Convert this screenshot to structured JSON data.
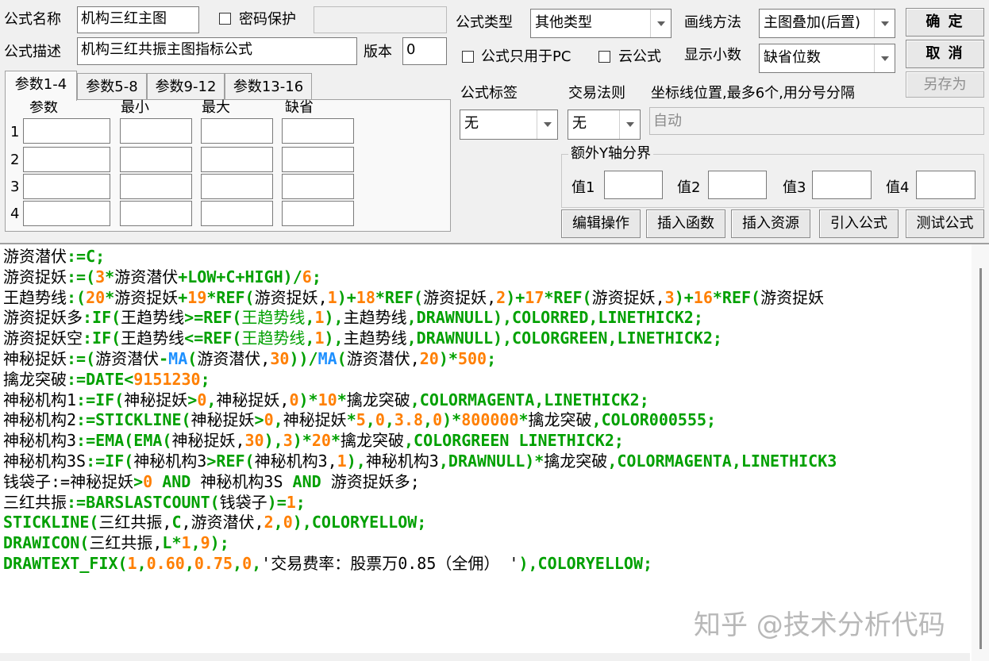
{
  "header": {
    "name_label": "公式名称",
    "name_value": "机构三红主图",
    "password_label": "密码保护",
    "desc_label": "公式描述",
    "desc_value": "机构三红共振主图指标公式",
    "version_label": "版本",
    "version_value": "0",
    "type_label": "公式类型",
    "type_value": "其他类型",
    "draw_label": "画线方法",
    "draw_value": "主图叠加(后置)",
    "pc_only_label": "公式只用于PC",
    "cloud_label": "云公式",
    "decimals_label": "显示小数",
    "decimals_value": "缺省位数"
  },
  "buttons": {
    "ok": "确 定",
    "cancel": "取 消",
    "save_as": "另存为",
    "edit_ops": "编辑操作",
    "insert_func": "插入函数",
    "insert_res": "插入资源",
    "import_formula": "引入公式",
    "test_formula": "测试公式"
  },
  "tabs": [
    "参数1-4",
    "参数5-8",
    "参数9-12",
    "参数13-16"
  ],
  "params": {
    "headers": [
      "参数",
      "最小",
      "最大",
      "缺省"
    ],
    "rows": [
      "1",
      "2",
      "3",
      "4"
    ]
  },
  "options": {
    "tag_label": "公式标签",
    "tag_value": "无",
    "rule_label": "交易法则",
    "rule_value": "无",
    "coord_label": "坐标线位置,最多6个,用分号分隔",
    "coord_placeholder": "自动",
    "yaxis_group": "额外Y轴分界",
    "v1": "值1",
    "v2": "值2",
    "v3": "值3",
    "v4": "值4"
  },
  "code": [
    [
      [
        "n",
        "游资潜伏"
      ],
      [
        "k",
        ":=C;"
      ]
    ],
    [
      [
        "n",
        "游资捉妖"
      ],
      [
        "k",
        ":=("
      ],
      [
        "num",
        "3"
      ],
      [
        "k",
        "*"
      ],
      [
        "n",
        "游资潜伏"
      ],
      [
        "k",
        "+LOW+C+HIGH)/"
      ],
      [
        "num",
        "6"
      ],
      [
        "k",
        ";"
      ]
    ],
    [
      [
        "n",
        "王趋势线"
      ],
      [
        "k",
        ":("
      ],
      [
        "num",
        "20"
      ],
      [
        "k",
        "*"
      ],
      [
        "n",
        "游资捉妖"
      ],
      [
        "k",
        "+"
      ],
      [
        "num",
        "19"
      ],
      [
        "k",
        "*REF("
      ],
      [
        "n",
        "游资捉妖,"
      ],
      [
        "num",
        "1"
      ],
      [
        "k",
        ")+"
      ],
      [
        "num",
        "18"
      ],
      [
        "k",
        "*REF("
      ],
      [
        "n",
        "游资捉妖,"
      ],
      [
        "num",
        "2"
      ],
      [
        "k",
        ")+"
      ],
      [
        "num",
        "17"
      ],
      [
        "k",
        "*REF("
      ],
      [
        "n",
        "游资捉妖,"
      ],
      [
        "num",
        "3"
      ],
      [
        "k",
        ")+"
      ],
      [
        "num",
        "16"
      ],
      [
        "k",
        "*REF("
      ],
      [
        "n",
        "游资捉妖"
      ]
    ],
    [
      [
        "n",
        "游资捉妖多"
      ],
      [
        "k",
        ":IF("
      ],
      [
        "n",
        "王趋势线"
      ],
      [
        "k",
        ">=REF("
      ],
      [
        "g",
        "王趋势线"
      ],
      [
        "k",
        ","
      ],
      [
        "num",
        "1"
      ],
      [
        "k",
        "),"
      ],
      [
        "n",
        "主趋势线"
      ],
      [
        "k",
        ",DRAWNULL),COLORRED,LINETHICK2;"
      ]
    ],
    [
      [
        "n",
        "游资捉妖空"
      ],
      [
        "k",
        ":IF("
      ],
      [
        "n",
        "王趋势线"
      ],
      [
        "k",
        "<=REF("
      ],
      [
        "g",
        "王趋势线"
      ],
      [
        "k",
        ","
      ],
      [
        "num",
        "1"
      ],
      [
        "k",
        "),"
      ],
      [
        "n",
        "主趋势线"
      ],
      [
        "k",
        ",DRAWNULL),COLORGREEN,LINETHICK2;"
      ]
    ],
    [
      [
        "n",
        "神秘捉妖"
      ],
      [
        "k",
        ":=("
      ],
      [
        "n",
        "游资潜伏"
      ],
      [
        "k",
        "-"
      ],
      [
        "blue",
        "MA"
      ],
      [
        "k",
        "("
      ],
      [
        "n",
        "游资潜伏,"
      ],
      [
        "num",
        "30"
      ],
      [
        "k",
        "))/"
      ],
      [
        "blue",
        "MA"
      ],
      [
        "k",
        "("
      ],
      [
        "n",
        "游资潜伏,"
      ],
      [
        "num",
        "20"
      ],
      [
        "k",
        ")*"
      ],
      [
        "num",
        "500"
      ],
      [
        "k",
        ";"
      ]
    ],
    [
      [
        "n",
        "擒龙突破"
      ],
      [
        "k",
        ":=DATE<"
      ],
      [
        "num",
        "9151230"
      ],
      [
        "k",
        ";"
      ]
    ],
    [
      [
        "n",
        "神秘机构1"
      ],
      [
        "k",
        ":=IF("
      ],
      [
        "n",
        "神秘捉妖"
      ],
      [
        "k",
        ">"
      ],
      [
        "num",
        "0"
      ],
      [
        "k",
        ","
      ],
      [
        "n",
        "神秘捉妖,"
      ],
      [
        "num",
        "0"
      ],
      [
        "k",
        ")*"
      ],
      [
        "num",
        "10"
      ],
      [
        "k",
        "*"
      ],
      [
        "n",
        "擒龙突破"
      ],
      [
        "k",
        ",COLORMAGENTA,LINETHICK2;"
      ]
    ],
    [
      [
        "n",
        "神秘机构2"
      ],
      [
        "k",
        ":=STICKLINE("
      ],
      [
        "n",
        "神秘捉妖"
      ],
      [
        "k",
        ">"
      ],
      [
        "num",
        "0"
      ],
      [
        "k",
        ","
      ],
      [
        "n",
        "神秘捉妖"
      ],
      [
        "k",
        "*"
      ],
      [
        "num",
        "5"
      ],
      [
        "k",
        ","
      ],
      [
        "num",
        "0"
      ],
      [
        "k",
        ","
      ],
      [
        "num",
        "3.8"
      ],
      [
        "k",
        ","
      ],
      [
        "num",
        "0"
      ],
      [
        "k",
        ")*"
      ],
      [
        "num",
        "800000"
      ],
      [
        "k",
        "*"
      ],
      [
        "n",
        "擒龙突破"
      ],
      [
        "k",
        ",COLOR000555;"
      ]
    ],
    [
      [
        "n",
        "神秘机构3"
      ],
      [
        "k",
        ":=EMA(EMA("
      ],
      [
        "n",
        "神秘捉妖,"
      ],
      [
        "num",
        "30"
      ],
      [
        "k",
        "),"
      ],
      [
        "num",
        "3"
      ],
      [
        "k",
        ")*"
      ],
      [
        "num",
        "20"
      ],
      [
        "k",
        "*"
      ],
      [
        "n",
        "擒龙突破"
      ],
      [
        "k",
        ",COLORGREEN LINETHICK2;"
      ]
    ],
    [
      [
        "n",
        "神秘机构3S"
      ],
      [
        "k",
        ":=IF("
      ],
      [
        "n",
        "神秘机构3"
      ],
      [
        "k",
        ">REF("
      ],
      [
        "n",
        "神秘机构3,"
      ],
      [
        "num",
        "1"
      ],
      [
        "k",
        "),"
      ],
      [
        "n",
        "神秘机构3"
      ],
      [
        "k",
        ",DRAWNULL)*"
      ],
      [
        "n",
        "擒龙突破"
      ],
      [
        "k",
        ",COLORMAGENTA,LINETHICK3"
      ]
    ],
    [
      [
        "n",
        "钱袋子:="
      ],
      [
        "n",
        "神秘捉妖"
      ],
      [
        "k",
        ">"
      ],
      [
        "num",
        "0"
      ],
      [
        "k",
        " AND "
      ],
      [
        "n",
        "神秘机构3S"
      ],
      [
        "k",
        " AND "
      ],
      [
        "n",
        "游资捉妖多;"
      ]
    ],
    [
      [
        "n",
        "三红共振"
      ],
      [
        "k",
        ":=BARSLASTCOUNT("
      ],
      [
        "n",
        "钱袋子"
      ],
      [
        "k",
        ")="
      ],
      [
        "num",
        "1"
      ],
      [
        "k",
        ";"
      ]
    ],
    [
      [
        "k",
        "STICKLINE("
      ],
      [
        "n",
        "三红共振,"
      ],
      [
        "k",
        "C"
      ],
      [
        "n",
        ","
      ],
      [
        "n",
        "游资潜伏,"
      ],
      [
        "num",
        "2"
      ],
      [
        "k",
        ","
      ],
      [
        "num",
        "0"
      ],
      [
        "k",
        "),COLORYELLOW;"
      ]
    ],
    [
      [
        "k",
        "DRAWICON("
      ],
      [
        "n",
        "三红共振,"
      ],
      [
        "k",
        "L*"
      ],
      [
        "num",
        "1"
      ],
      [
        "k",
        ","
      ],
      [
        "num",
        "9"
      ],
      [
        "k",
        ");"
      ]
    ],
    [
      [
        "k",
        "DRAWTEXT_FIX("
      ],
      [
        "num",
        "1"
      ],
      [
        "k",
        ","
      ],
      [
        "num",
        "0.60"
      ],
      [
        "k",
        ","
      ],
      [
        "num",
        "0.75"
      ],
      [
        "k",
        ","
      ],
      [
        "num",
        "0"
      ],
      [
        "k",
        ","
      ],
      [
        "n",
        "'交易费率：股票万"
      ],
      [
        "n",
        "0.85（全佣） '"
      ],
      [
        "k",
        "),COLORYELLOW;"
      ]
    ]
  ],
  "watermark": "知乎 @技术分析代码"
}
